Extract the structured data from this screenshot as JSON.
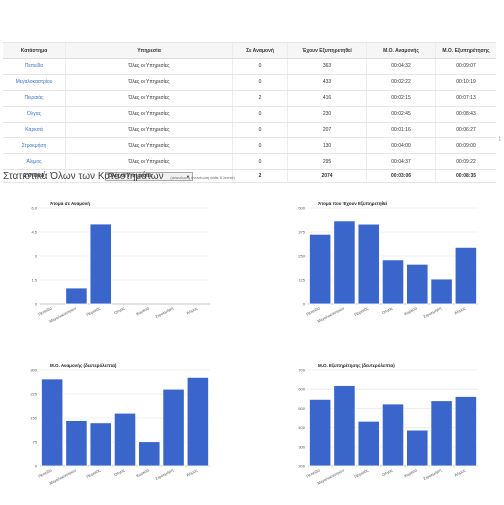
{
  "table": {
    "headers": [
      "Κατάστημα",
      "Υπηρεσία",
      "Σε Αναμονή",
      "Έχουν Εξυπηρετηθεί",
      "Μ.Ο. Αναμονής",
      "Μ.Ο. Εξυπηρέτησης"
    ],
    "rows": [
      {
        "store": "Πεπείδα",
        "service": "Όλες οι Υπηρεσίες",
        "waiting": "0",
        "served": "363",
        "avg_wait": "00:04:32",
        "avg_service": "00:09:07"
      },
      {
        "store": "Μεγαλοκαστρίου",
        "service": "Όλες οι Υπηρεσίες",
        "waiting": "0",
        "served": "433",
        "avg_wait": "00:02:22",
        "avg_service": "00:10:19"
      },
      {
        "store": "Πειραιάς",
        "service": "Όλες οι Υπηρεσίες",
        "waiting": "2",
        "served": "416",
        "avg_wait": "00:02:15",
        "avg_service": "00:07:13"
      },
      {
        "store": "Ολγας",
        "service": "Όλες οι Υπηρεσίες",
        "waiting": "0",
        "served": "230",
        "avg_wait": "00:02:45",
        "avg_service": "00:08:43"
      },
      {
        "store": "Καρκσά",
        "service": "Όλες οι Υπηρεσίες",
        "waiting": "0",
        "served": "207",
        "avg_wait": "00:01:16",
        "avg_service": "00:06:27"
      },
      {
        "store": "Στροκμήση",
        "service": "Όλες οι Υπηρεσίες",
        "waiting": "0",
        "served": "130",
        "avg_wait": "00:04:00",
        "avg_service": "00:09:00"
      },
      {
        "store": "Άλιμος",
        "service": "Όλες οι Υπηρεσίες",
        "waiting": "0",
        "served": "295",
        "avg_wait": "00:04:37",
        "avg_service": "00:09:22"
      }
    ],
    "total": {
      "label": "ΣΥΝΟΛΑ",
      "select_value": "Όλες οι Υπηρεσίες",
      "waiting": "2",
      "served": "2074",
      "avg_wait": "00:03:06",
      "avg_service": "00:08:35"
    }
  },
  "side_mark": "⁞",
  "section": {
    "title": "Στατιστικά Όλων των Καταστημάτων",
    "note": "(ανανέωση ανανέωση κάθε 5 λεπτά)"
  },
  "colors": {
    "bar": "#3a66cc",
    "grid": "#e3e3e3",
    "link": "#3a74c7"
  },
  "chart_data": [
    {
      "type": "bar",
      "title": "Άτομα σε Αναμονή",
      "categories": [
        "Πεπείδα",
        "Μεγαλοκαστρίου",
        "Πειραιάς",
        "Ολγας",
        "Καρκσά",
        "Στροκμήση",
        "Άλιμος"
      ],
      "values": [
        0,
        1,
        5,
        0,
        0,
        0,
        0
      ],
      "ylim": [
        0,
        6
      ],
      "yticks": [
        "0",
        "1.5",
        "3",
        "4.5",
        "6.0"
      ],
      "grid": true
    },
    {
      "type": "bar",
      "title": "Άτομα που Έχουν Εξυπηρετηθεί",
      "categories": [
        "Πεπείδα",
        "Μεγαλοκαστρίου",
        "Πειραιάς",
        "Ολγας",
        "Καρκσά",
        "Στροκμήση",
        "Άλιμος"
      ],
      "values": [
        363,
        433,
        416,
        230,
        207,
        130,
        295
      ],
      "ylim": [
        0,
        500
      ],
      "yticks": [
        "0",
        "125",
        "250",
        "375",
        "500"
      ],
      "grid": true
    },
    {
      "type": "bar",
      "title": "Μ.Ο. Αναμονής (δευτερόλεπτα)",
      "categories": [
        "Πεπείδα",
        "Μεγαλοκαστρίου",
        "Πειραιάς",
        "Ολγας",
        "Καρκσά",
        "Στροκμήση",
        "Άλιμος"
      ],
      "values": [
        272,
        142,
        135,
        165,
        76,
        240,
        277
      ],
      "ylim": [
        0,
        300
      ],
      "yticks": [
        "0",
        "75",
        "150",
        "225",
        "300"
      ],
      "grid": true
    },
    {
      "type": "bar",
      "title": "Μ.Ο. Εξυπηρέτησης (δευτερόλεπτα)",
      "categories": [
        "Πεπείδα",
        "Μεγαλοκαστρίου",
        "Πειραιάς",
        "Ολγας",
        "Καρκσά",
        "Στροκμήση",
        "Άλιμος"
      ],
      "values": [
        547,
        619,
        433,
        523,
        387,
        540,
        562
      ],
      "ylim": [
        200,
        700
      ],
      "yticks": [
        "200",
        "300",
        "400",
        "500",
        "600",
        "700"
      ],
      "grid": true
    }
  ]
}
